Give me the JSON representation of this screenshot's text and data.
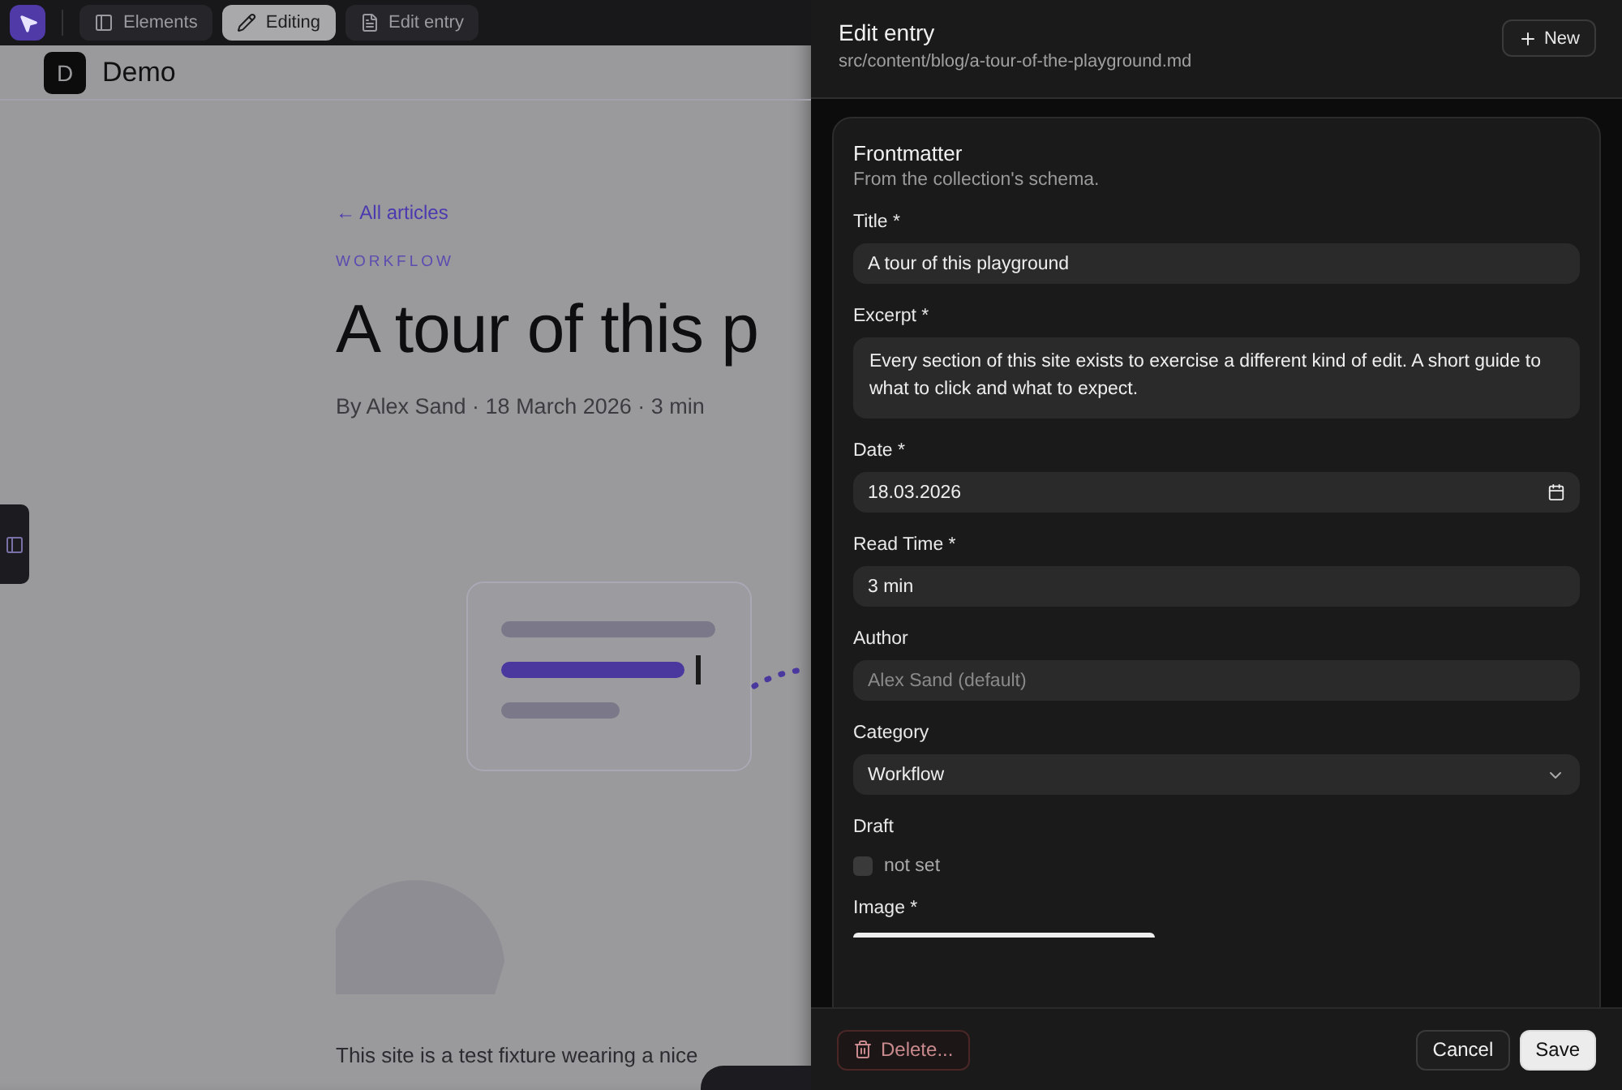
{
  "toolbar": {
    "tabs": [
      {
        "label": "Elements",
        "selected": false
      },
      {
        "label": "Editing",
        "selected": true
      },
      {
        "label": "Edit entry",
        "selected": false
      }
    ]
  },
  "page": {
    "logo": "D",
    "site_name": "Demo",
    "back_link": "← All articles",
    "category": "WORKFLOW",
    "title": "A tour of this p",
    "byline": "By Alex Sand · 18 March 2026 · 3 min",
    "body": "This site is a test fixture wearing a nice"
  },
  "panel": {
    "title": "Edit entry",
    "path": "src/content/blog/a-tour-of-the-playground.md",
    "new_button": "New",
    "section": {
      "title": "Frontmatter",
      "subtitle": "From the collection's schema.",
      "fields": [
        {
          "kind": "text",
          "label": "Title *",
          "value": "A tour of this playground"
        },
        {
          "kind": "textarea",
          "label": "Excerpt *",
          "value": "Every section of this site exists to exercise a different kind of edit. A short guide to what to click and what to expect."
        },
        {
          "kind": "date",
          "label": "Date *",
          "value": "18.03.2026"
        },
        {
          "kind": "text",
          "label": "Read Time *",
          "value": "3 min"
        },
        {
          "kind": "text",
          "label": "Author",
          "placeholder": "Alex Sand (default)"
        },
        {
          "kind": "select",
          "label": "Category",
          "value": "Workflow"
        },
        {
          "kind": "checkbox",
          "label": "Draft",
          "checked": false,
          "value": "not set"
        },
        {
          "kind": "image",
          "label": "Image *"
        }
      ]
    },
    "footer": {
      "delete": "Delete...",
      "cancel": "Cancel",
      "save": "Save"
    }
  }
}
